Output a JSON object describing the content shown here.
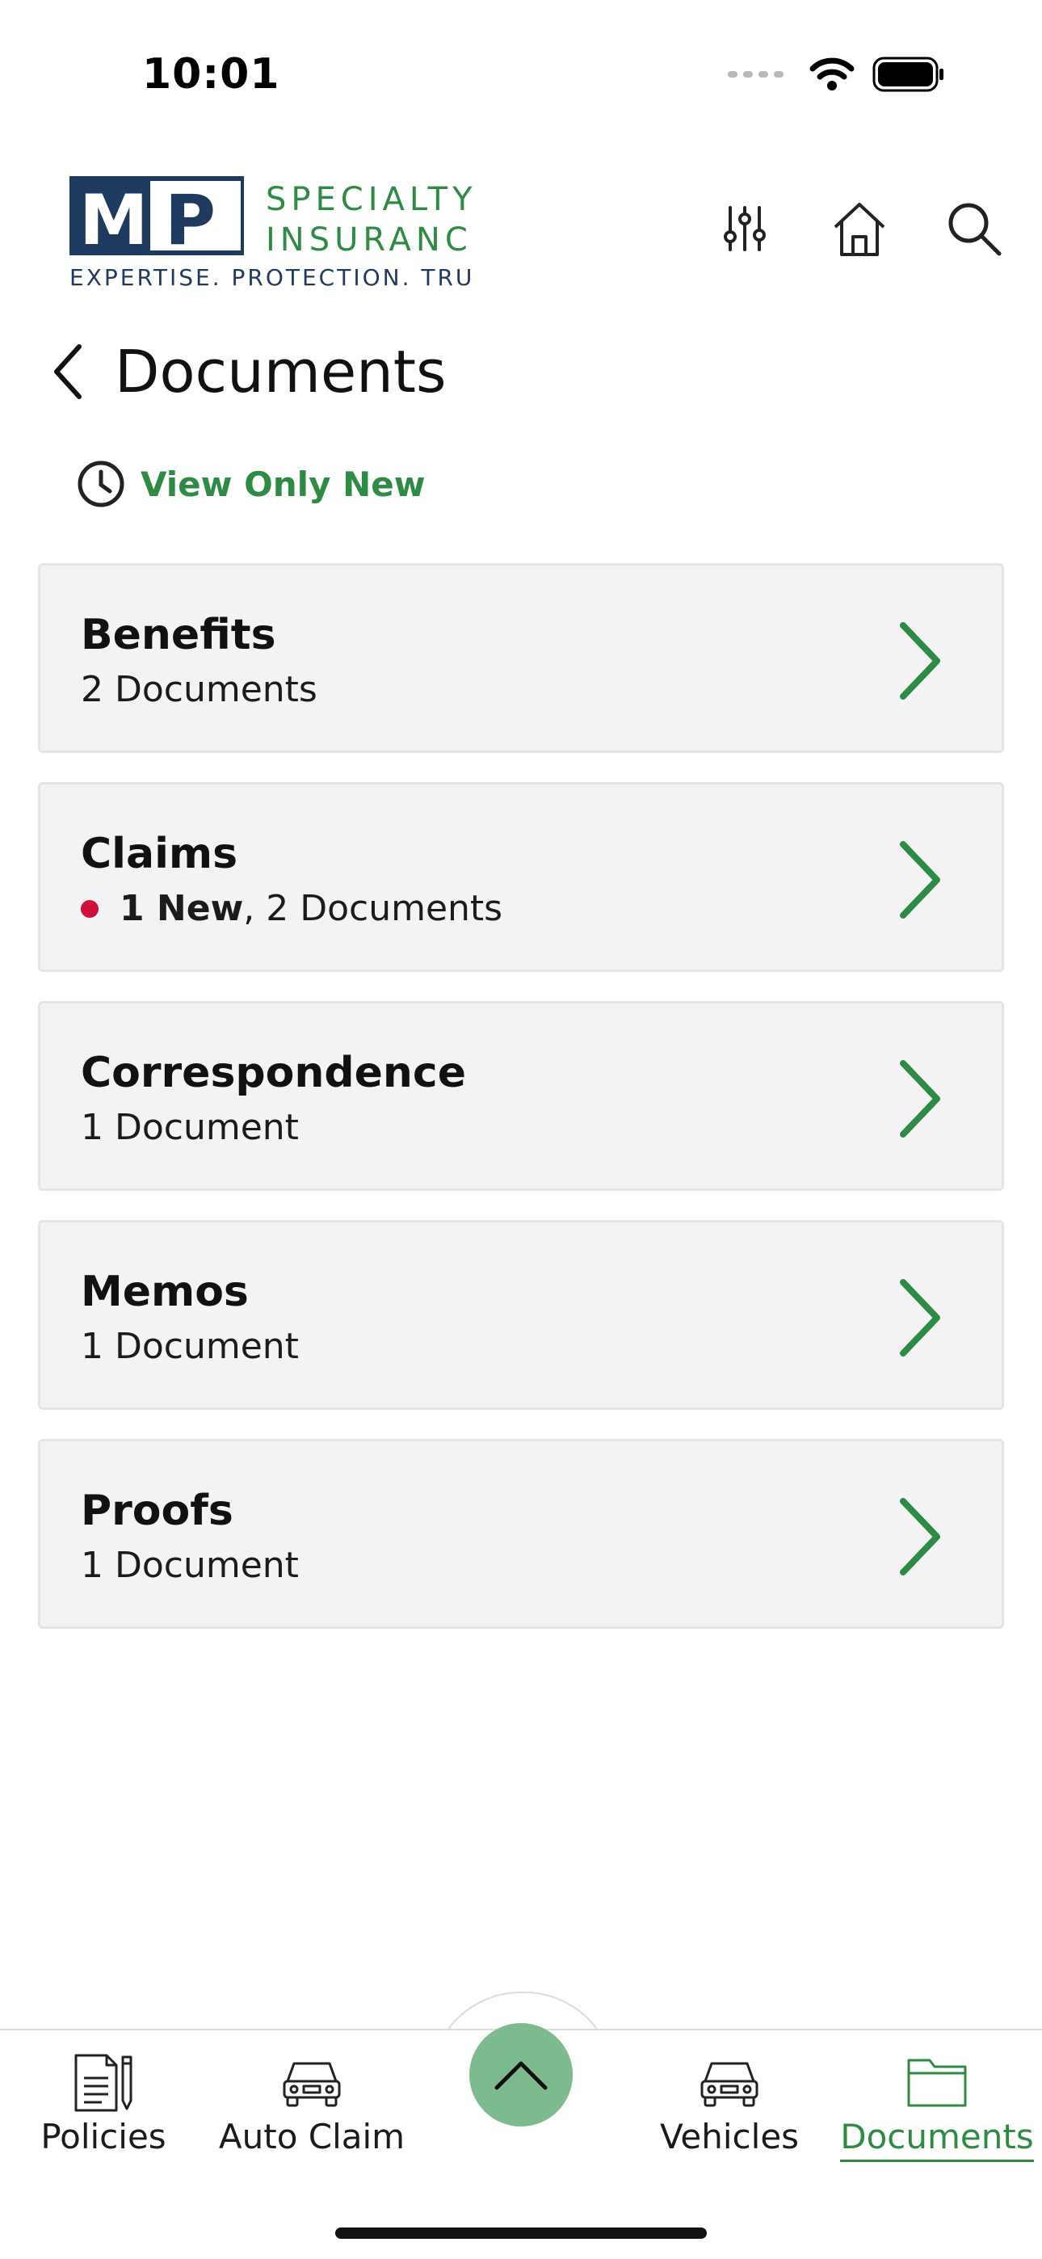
{
  "status_bar": {
    "time": "10:01"
  },
  "logo": {
    "letters": "MP",
    "line1": "SPECIALTY",
    "line2": "INSURANCE",
    "tagline": "EXPERTISE. PROTECTION. TRUST.",
    "colors": {
      "navy": "#1f3a5f",
      "green": "#2e8b43"
    }
  },
  "header": {
    "icons": [
      "sliders-icon",
      "home-icon",
      "search-icon"
    ]
  },
  "page": {
    "title": "Documents",
    "filter_label": "View Only New"
  },
  "categories": [
    {
      "title": "Benefits",
      "subtitle": "2 Documents"
    },
    {
      "title": "Claims",
      "new_label": "1 New",
      "subtitle_rest": ", 2 Documents"
    },
    {
      "title": "Correspondence",
      "subtitle": "1 Document"
    },
    {
      "title": "Memos",
      "subtitle": "1 Document"
    },
    {
      "title": "Proofs",
      "subtitle": "1 Document"
    }
  ],
  "tabs": [
    {
      "label": "Policies",
      "icon": "policy-document-icon"
    },
    {
      "label": "Auto Claim",
      "icon": "car-icon"
    },
    {
      "label": "Vehicles",
      "icon": "car-icon"
    },
    {
      "label": "Documents",
      "icon": "folder-icon",
      "active": true
    }
  ],
  "colors": {
    "accent": "#2e8b43",
    "new_dot": "#d0103a",
    "fab": "#7dba8e"
  }
}
